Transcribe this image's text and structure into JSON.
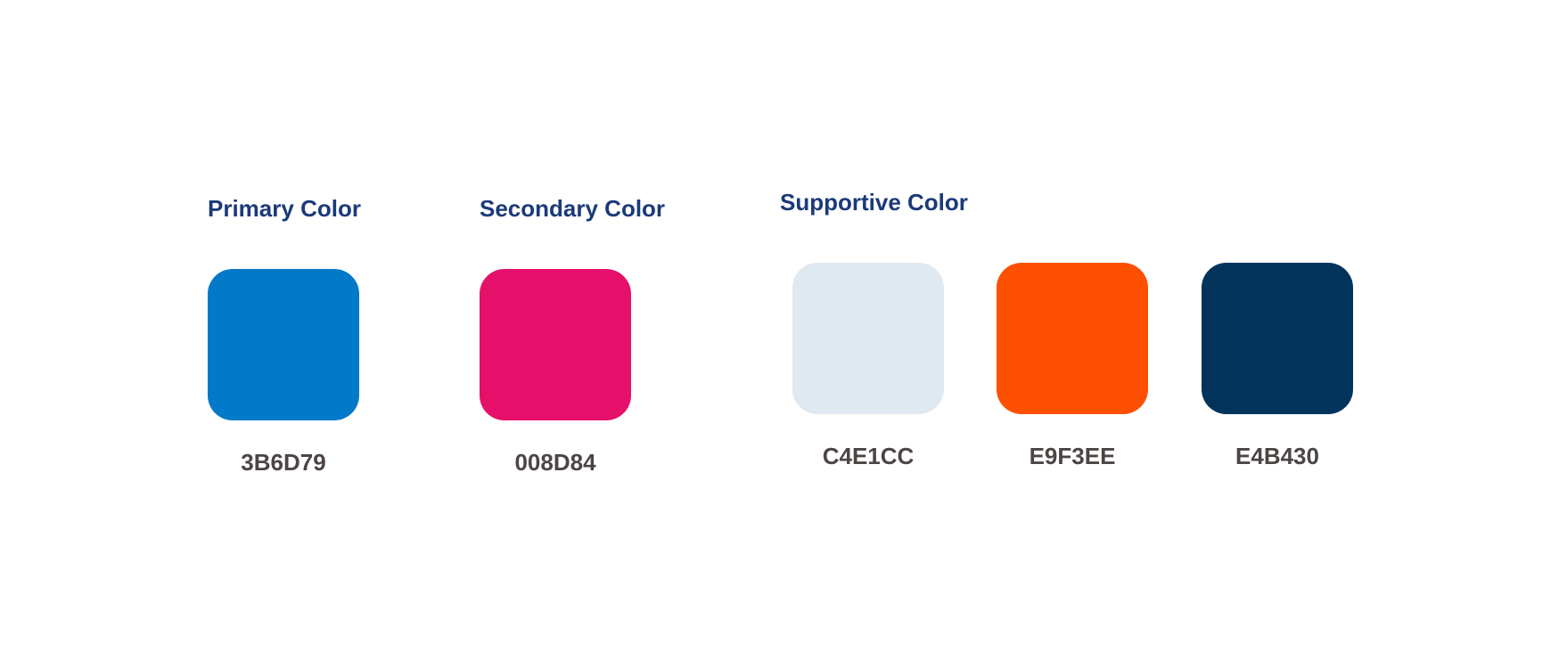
{
  "groups": {
    "primary": {
      "title": "Primary Color",
      "swatches": [
        {
          "code": "3B6D79",
          "color": "#0279c9"
        }
      ]
    },
    "secondary": {
      "title": "Secondary Color",
      "swatches": [
        {
          "code": "008D84",
          "color": "#e5106a"
        }
      ]
    },
    "supportive": {
      "title": "Supportive Color",
      "swatches": [
        {
          "code": "C4E1CC",
          "color": "#dfe9f2"
        },
        {
          "code": "E9F3EE",
          "color": "#fe5003"
        },
        {
          "code": "E4B430",
          "color": "#02345b"
        }
      ]
    }
  }
}
